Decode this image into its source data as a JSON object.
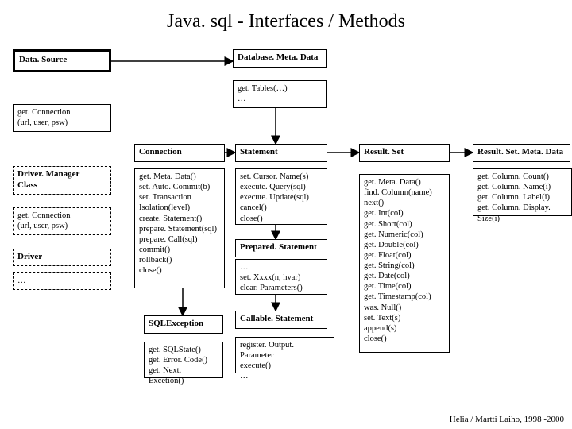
{
  "title": "Java. sql - Interfaces / Methods",
  "datasource": {
    "label": "Data. Source"
  },
  "dbmeta": {
    "label": "Database. Meta. Data",
    "body": "get. Tables(…)\n…"
  },
  "getconn1": {
    "body": "get. Connection\n   (url, user, psw)"
  },
  "drivermgr": {
    "label": "Driver. Manager\nClass"
  },
  "getconn2": {
    "body": "get. Connection\n   (url, user, psw)"
  },
  "driver": {
    "label": "Driver",
    "body": "…"
  },
  "connection": {
    "label": "Connection",
    "body": "get. Meta. Data()\nset. Auto. Commit(b)\nset. Transaction\n    Isolation(level)\ncreate. Statement()\nprepare. Statement(sql)\nprepare. Call(sql)\ncommit()\nrollback()\nclose()"
  },
  "statement": {
    "label": "Statement",
    "body": "set. Cursor. Name(s)\nexecute. Query(sql)\nexecute. Update(sql)\ncancel()\nclose()"
  },
  "prepstmt": {
    "label": "Prepared. Statement",
    "body": "…\nset. Xxxx(n, hvar)\nclear. Parameters()"
  },
  "callstmt": {
    "label": "Callable. Statement",
    "body": "register. Output. Parameter\nexecute()\n…"
  },
  "sqlex": {
    "label": "SQLException",
    "body": "get. SQLState()\nget. Error. Code()\nget. Next. Excetion()"
  },
  "resultset": {
    "label": "Result. Set",
    "body": "get. Meta. Data()\nfind. Column(name)\nnext()\nget. Int(col)\nget. Short(col)\nget. Numeric(col)\nget. Double(col)\nget. Float(col)\nget. String(col)\nget. Date(col)\nget. Time(col)\nget. Timestamp(col)\nwas. Null()\nset. Text(s)\nappend(s)\nclose()"
  },
  "rsmeta": {
    "label": "Result. Set. Meta. Data",
    "body": "get. Column. Count()\nget. Column. Name(i)\nget. Column. Label(i)\nget. Column. Display. Size(i)"
  },
  "footer": "Helia / Martti Laiho, 1998 -2000"
}
